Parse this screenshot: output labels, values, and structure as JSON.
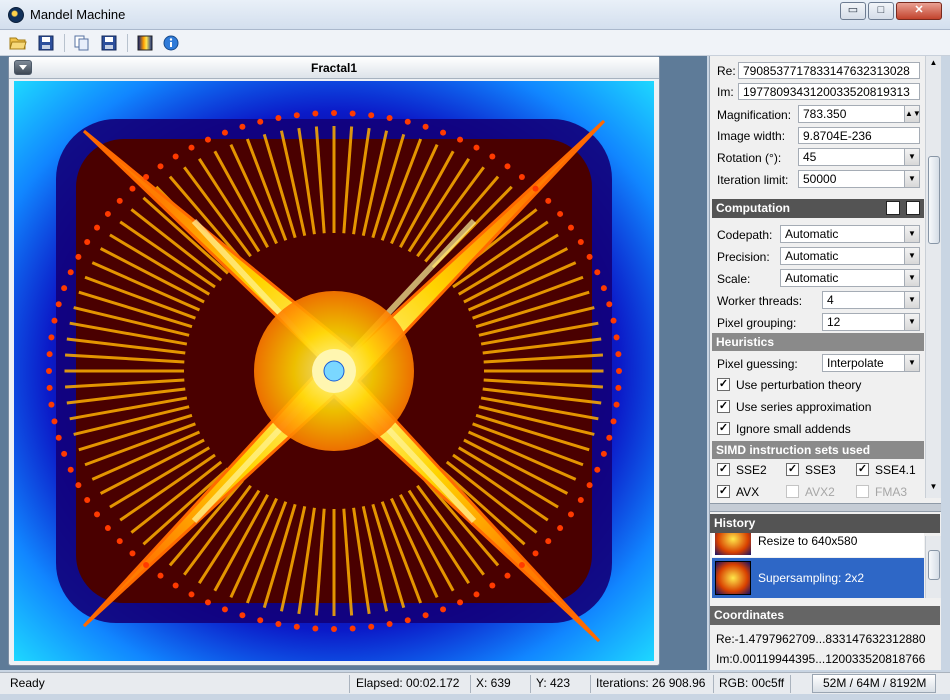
{
  "window": {
    "title": "Mandel Machine",
    "minimize": "▭",
    "maximize": "□",
    "close": "✕"
  },
  "toolbar": {
    "icons": [
      "open-folder-icon",
      "save-icon",
      "copy-icon",
      "save-image-icon",
      "palette-icon",
      "info-icon"
    ]
  },
  "frame": {
    "title": "Fractal1"
  },
  "location": {
    "re_label": "Re:",
    "re_value": "7908537717833147632313028",
    "im_label": "Im:",
    "im_value": "1977809343120033520819313",
    "magnification_label": "Magnification:",
    "magnification_value": "783.350",
    "image_width_label": "Image width:",
    "image_width_value": "9.8704E-236",
    "rotation_label": "Rotation (°):",
    "rotation_value": "45",
    "iteration_limit_label": "Iteration limit:",
    "iteration_limit_value": "50000"
  },
  "computation": {
    "title": "Computation",
    "codepath_label": "Codepath:",
    "codepath_value": "Automatic",
    "precision_label": "Precision:",
    "precision_value": "Automatic",
    "scale_label": "Scale:",
    "scale_value": "Automatic",
    "threads_label": "Worker threads:",
    "threads_value": "4",
    "grouping_label": "Pixel grouping:",
    "grouping_value": "12"
  },
  "heuristics": {
    "title": "Heuristics",
    "guessing_label": "Pixel guessing:",
    "guessing_value": "Interpolate",
    "perturbation": "Use perturbation theory",
    "series": "Use series approximation",
    "addends": "Ignore small addends"
  },
  "simd": {
    "title": "SIMD instruction sets used",
    "sets": [
      {
        "name": "SSE2",
        "checked": true,
        "enabled": true
      },
      {
        "name": "SSE3",
        "checked": true,
        "enabled": true
      },
      {
        "name": "SSE4.1",
        "checked": true,
        "enabled": true
      },
      {
        "name": "AVX",
        "checked": true,
        "enabled": true
      },
      {
        "name": "AVX2",
        "checked": false,
        "enabled": false
      },
      {
        "name": "FMA3",
        "checked": false,
        "enabled": false
      }
    ]
  },
  "history": {
    "title": "History",
    "items": [
      {
        "label": "Resize to 640x580",
        "selected": false
      },
      {
        "label": "Supersampling: 2x2",
        "selected": true
      }
    ]
  },
  "coordinates": {
    "title": "Coordinates",
    "re": "Re:-1.4797962709...833147632312880",
    "im": "Im:0.00119944395...120033520818766"
  },
  "status": {
    "ready": "Ready",
    "elapsed": "Elapsed: 00:02.172",
    "x": "X: 639",
    "y": "Y: 423",
    "iterations": "Iterations: 26 908.96",
    "rgb": "RGB: 00c5ff",
    "memory": "52M / 64M / 8192M"
  },
  "colors": {
    "accent": "#2e67c6",
    "fractal_outer": "#1fc3ff",
    "fractal_mid": "#0a1ab0",
    "fractal_core": "#ffd400"
  }
}
